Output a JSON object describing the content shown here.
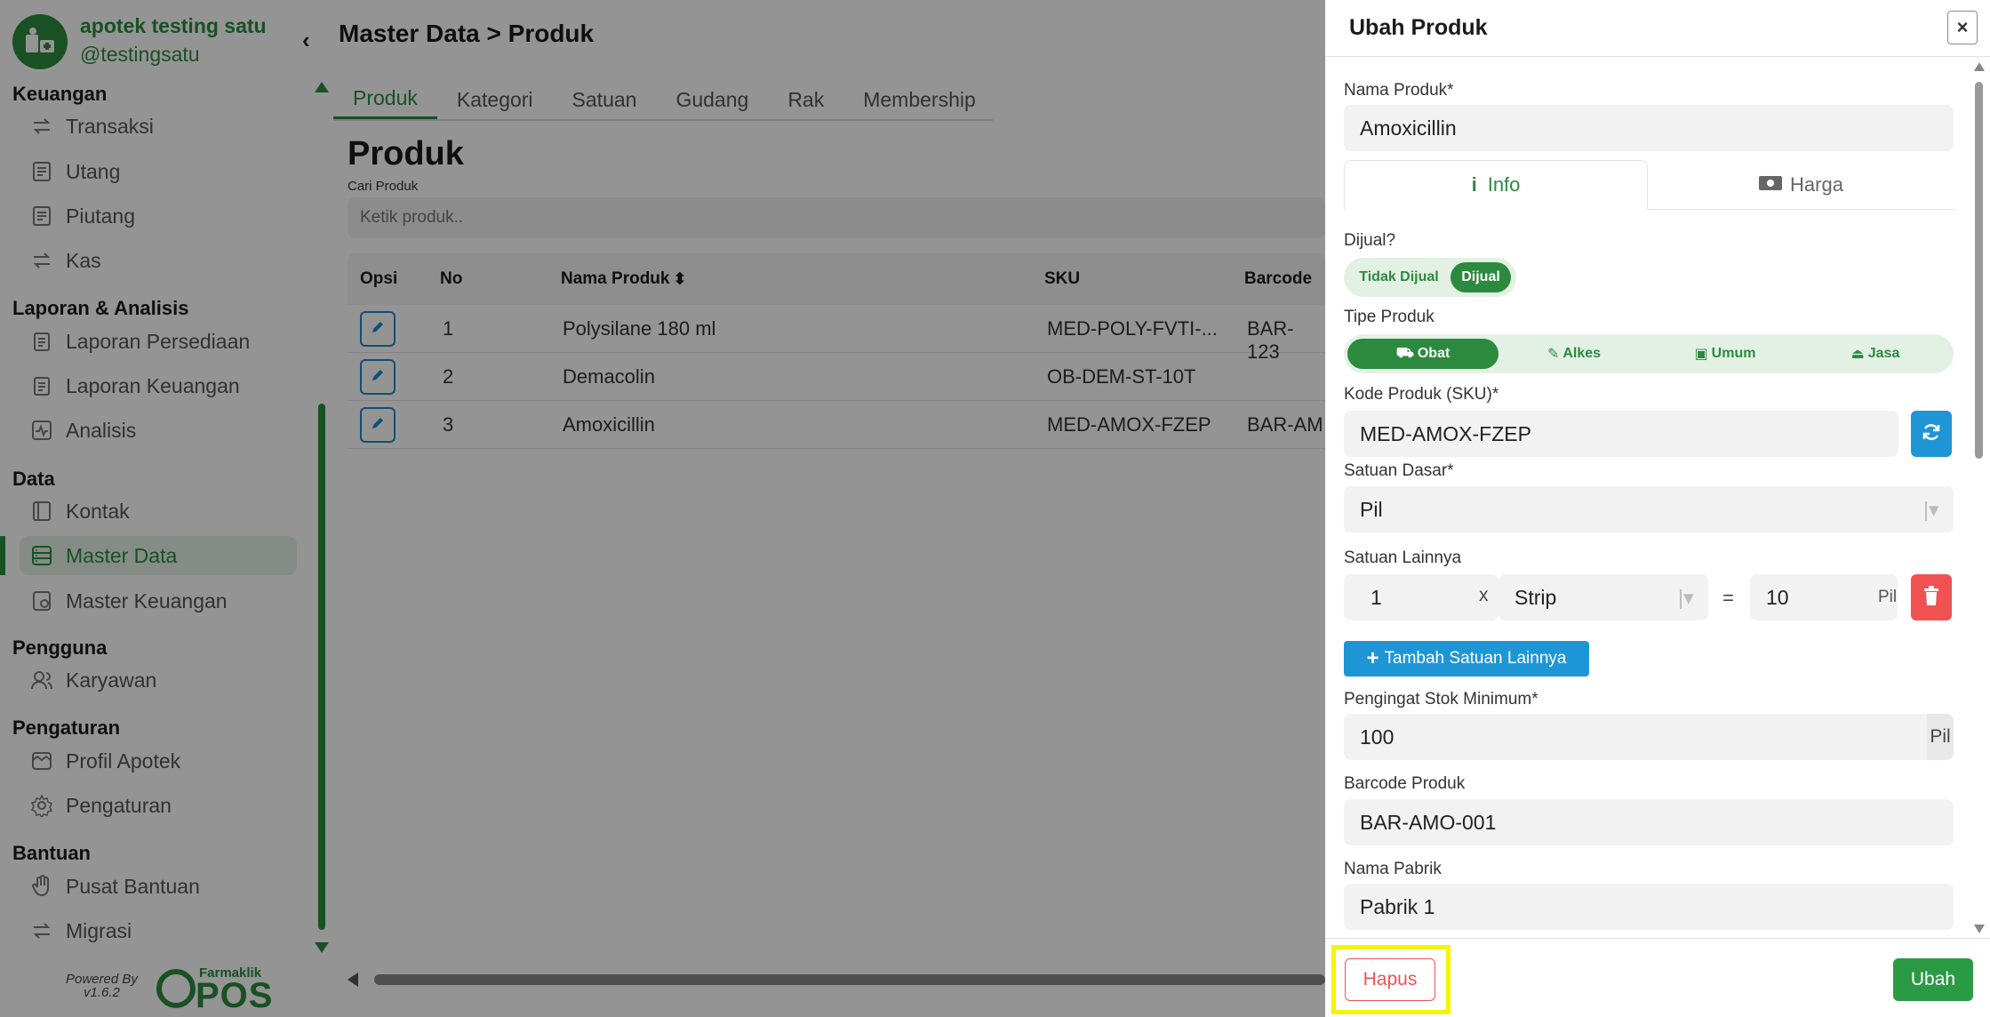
{
  "brand": {
    "name": "apotek testing satu",
    "handle": "@testingsatu"
  },
  "sidebar": {
    "sections": [
      {
        "title": "Keuangan",
        "items": [
          "Transaksi",
          "Utang",
          "Piutang",
          "Kas"
        ]
      },
      {
        "title": "Laporan & Analisis",
        "items": [
          "Laporan Persediaan",
          "Laporan Keuangan",
          "Analisis"
        ]
      },
      {
        "title": "Data",
        "items": [
          "Kontak",
          "Master Data",
          "Master Keuangan"
        ]
      },
      {
        "title": "Pengguna",
        "items": [
          "Karyawan"
        ]
      },
      {
        "title": "Pengaturan",
        "items": [
          "Profil Apotek",
          "Pengaturan"
        ]
      },
      {
        "title": "Bantuan",
        "items": [
          "Pusat Bantuan",
          "Migrasi"
        ]
      }
    ],
    "active_item": "Master Data",
    "powered_by": "Powered By",
    "version": "v1.6.2",
    "footer_logo_top": "Farmaklik",
    "footer_logo_main": "POS"
  },
  "main": {
    "breadcrumb": "Master Data > Produk",
    "tabs": [
      "Produk",
      "Kategori",
      "Satuan",
      "Gudang",
      "Rak",
      "Membership"
    ],
    "active_tab": "Produk",
    "page_title": "Produk",
    "search_label": "Cari Produk",
    "search_placeholder": "Ketik produk..",
    "table": {
      "headers": [
        "Opsi",
        "No",
        "Nama Produk",
        "SKU",
        "Barcode"
      ],
      "rows": [
        {
          "no": "1",
          "name": "Polysilane 180 ml",
          "sku": "MED-POLY-FVTI-...",
          "barcode": "BAR-123"
        },
        {
          "no": "2",
          "name": "Demacolin",
          "sku": "OB-DEM-ST-10T",
          "barcode": ""
        },
        {
          "no": "3",
          "name": "Amoxicillin",
          "sku": "MED-AMOX-FZEP",
          "barcode": "BAR-AM"
        }
      ]
    }
  },
  "modal": {
    "title": "Ubah Produk",
    "nama_produk_label": "Nama Produk*",
    "nama_produk_value": "Amoxicillin",
    "tab_info": "Info",
    "tab_harga": "Harga",
    "dijual_label": "Dijual?",
    "dijual_options": [
      "Tidak Dijual",
      "Dijual"
    ],
    "dijual_selected": "Dijual",
    "tipe_label": "Tipe Produk",
    "tipe_options": [
      "Obat",
      "Alkes",
      "Umum",
      "Jasa"
    ],
    "tipe_selected": "Obat",
    "sku_label": "Kode Produk (SKU)*",
    "sku_value": "MED-AMOX-FZEP",
    "satuan_dasar_label": "Satuan Dasar*",
    "satuan_dasar_value": "Pil",
    "satuan_lain_label": "Satuan Lainnya",
    "satuan_lain_qty": "1",
    "satuan_lain_x": "x",
    "satuan_lain_unit": "Strip",
    "satuan_lain_eq": "=",
    "satuan_lain_conv": "10",
    "satuan_lain_conv_unit": "Pil",
    "add_unit_label": "Tambah Satuan Lainnya",
    "stok_min_label": "Pengingat Stok Minimum*",
    "stok_min_value": "100",
    "stok_min_unit": "Pil",
    "barcode_label": "Barcode Produk",
    "barcode_value": "BAR-AMO-001",
    "pabrik_label": "Nama Pabrik",
    "pabrik_value": "Pabrik 1",
    "hapus_label": "Hapus",
    "ubah_label": "Ubah",
    "close_label": "×"
  },
  "colors": {
    "brand_green": "#2b8a3e",
    "accent_blue": "#1e96d6",
    "danger_red": "#f05252",
    "highlight_yellow": "#f5f500"
  }
}
